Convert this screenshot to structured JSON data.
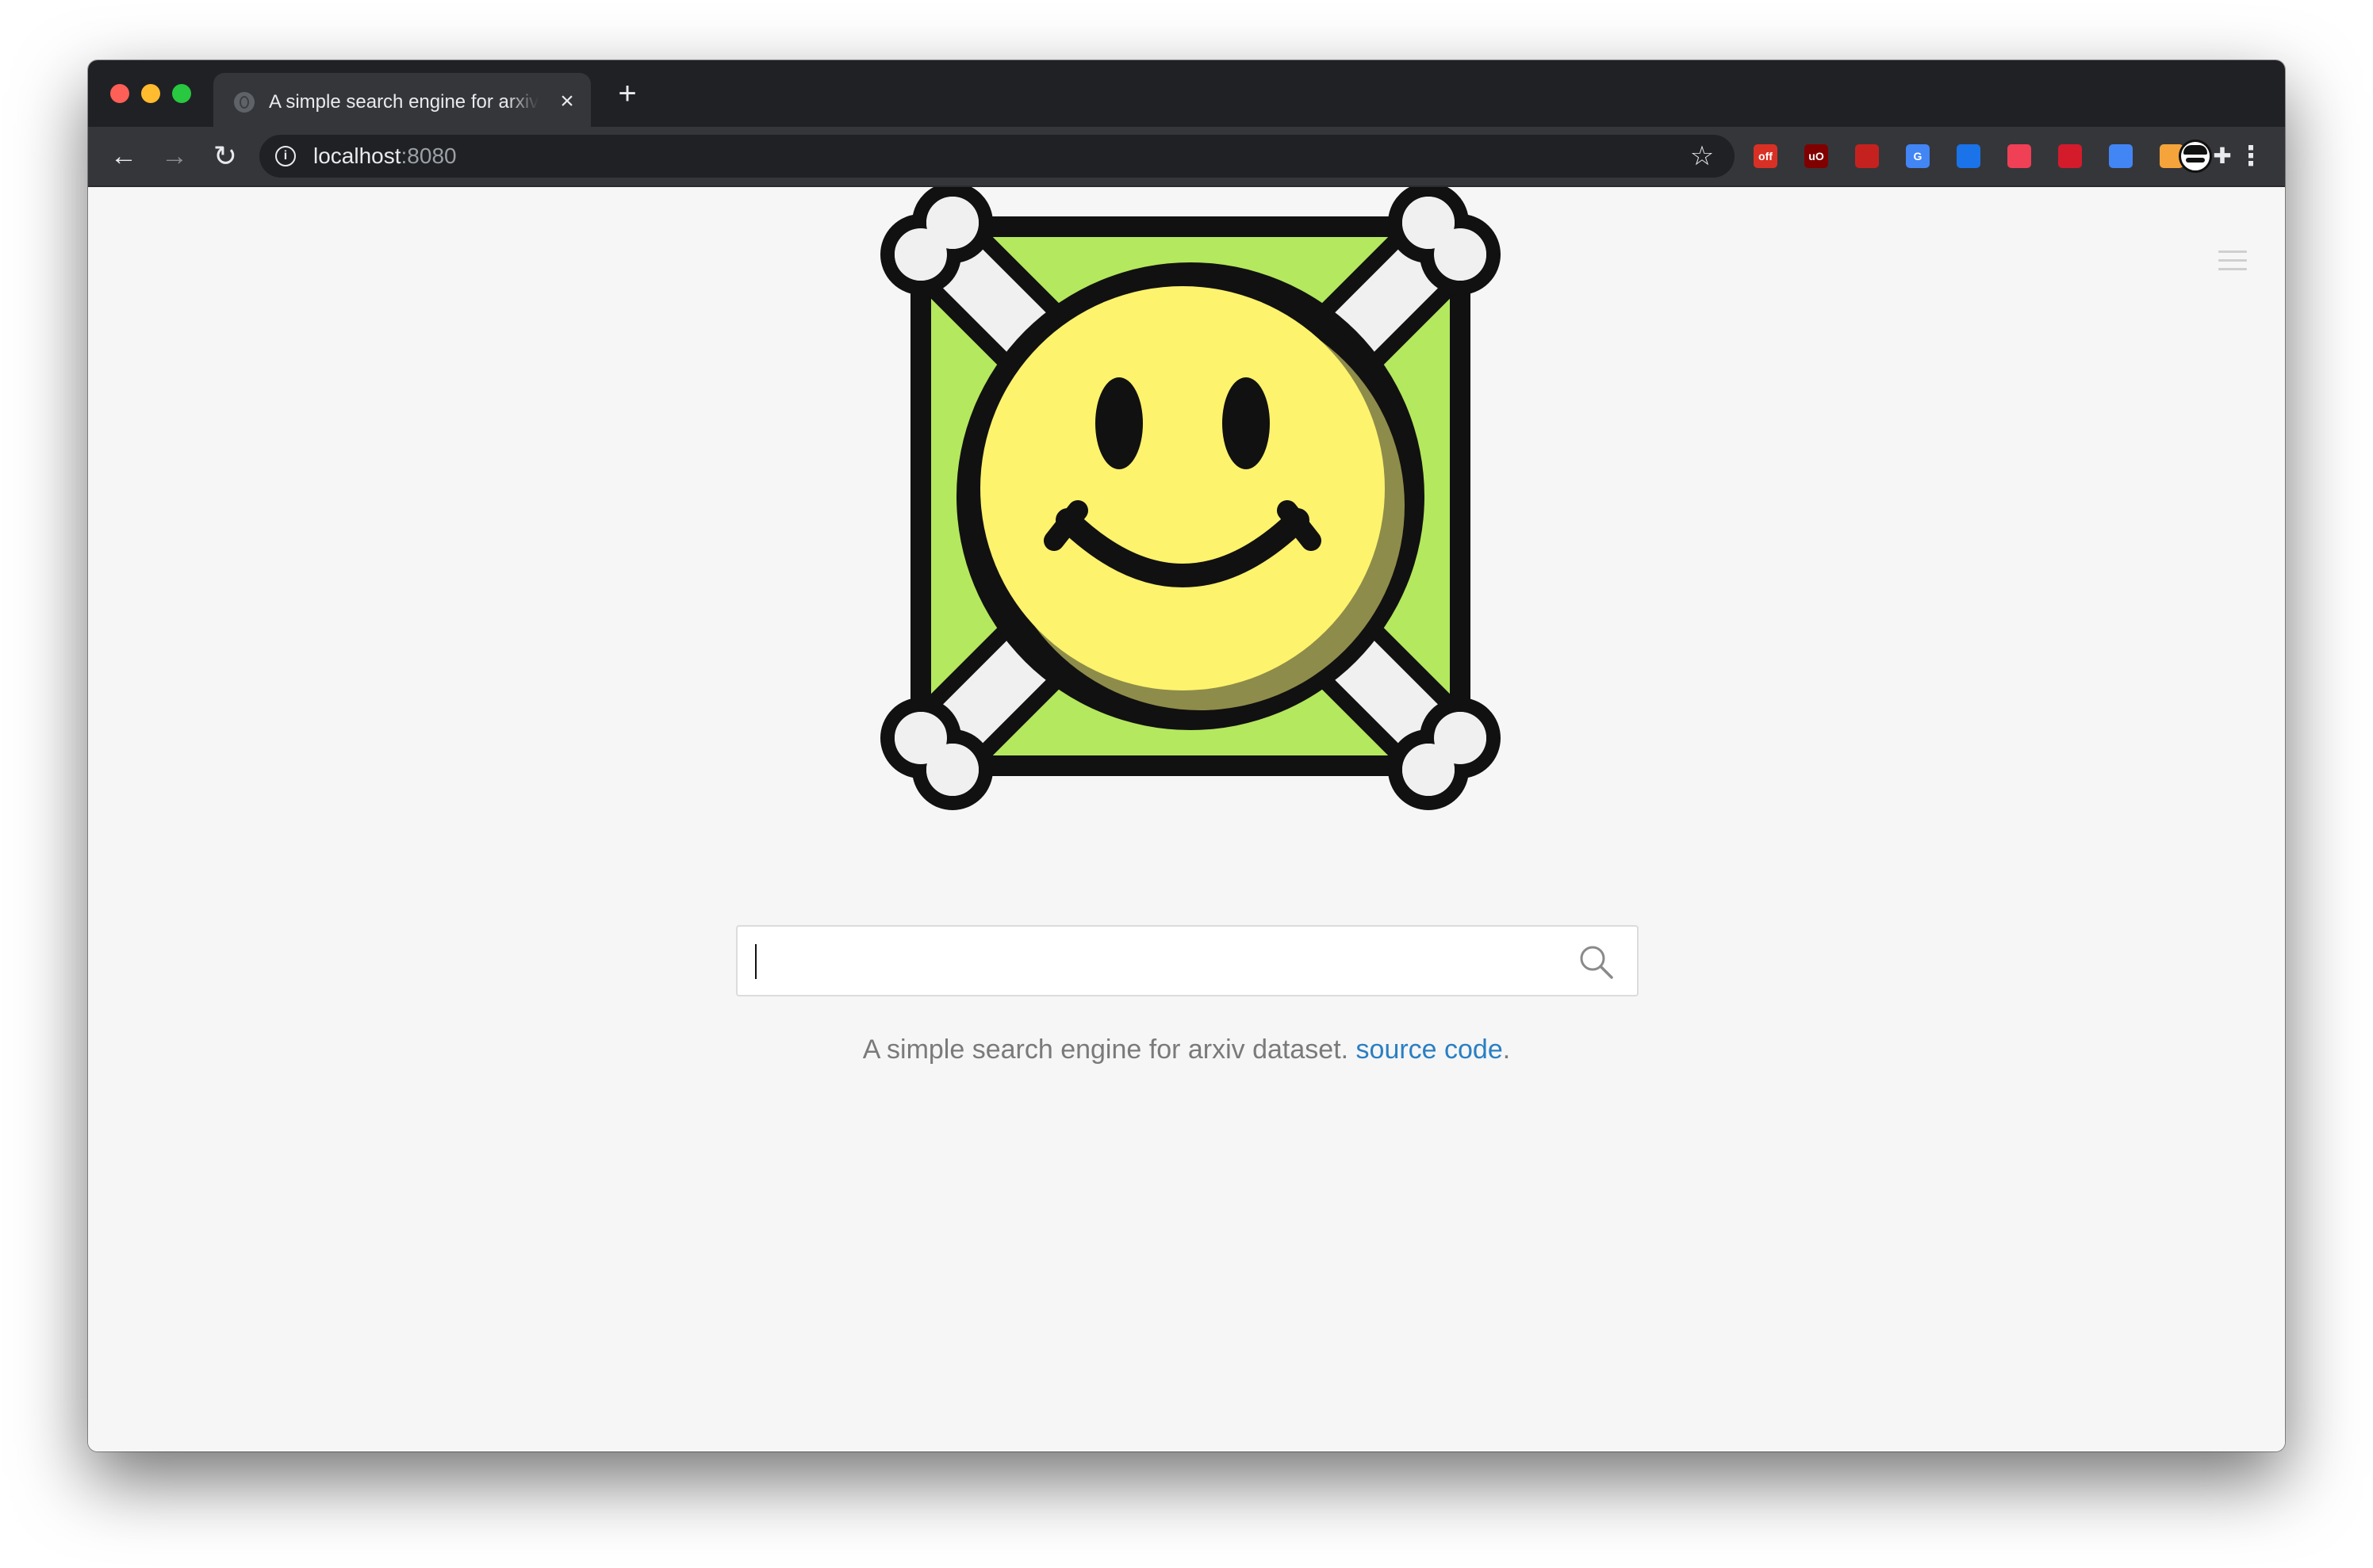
{
  "browser": {
    "tab": {
      "title": "A simple search engine for arxiv dataset",
      "close": "×"
    },
    "new_tab": "+",
    "nav": {
      "back": "←",
      "forward": "→",
      "reload": "↻"
    },
    "address": {
      "host": "localhost",
      "port": ":8080"
    },
    "bookmark_icon": "☆",
    "menu": "⋮",
    "extensions": [
      {
        "name": "off-extension-icon",
        "badge": "off",
        "color": "#d93025"
      },
      {
        "name": "ublock-icon",
        "badge": "uO",
        "color": "#800000"
      },
      {
        "name": "bookmark-ext-icon",
        "badge": "",
        "color": "#c5221f"
      },
      {
        "name": "google-translate-icon",
        "badge": "G",
        "color": "#4285f4"
      },
      {
        "name": "screenshot-ext-icon",
        "badge": "",
        "color": "#1a73e8"
      },
      {
        "name": "pocket-icon",
        "badge": "",
        "color": "#ef4056"
      },
      {
        "name": "mendeley-icon",
        "badge": "",
        "color": "#d41b2c"
      },
      {
        "name": "scholar-icon",
        "badge": "",
        "color": "#4285f4"
      },
      {
        "name": "note-ext-icon",
        "badge": "",
        "color": "#f4a43a"
      },
      {
        "name": "extensions-puzzle-icon",
        "badge": "",
        "color": "#e8eaed"
      }
    ]
  },
  "page": {
    "search": {
      "placeholder": "",
      "value": ""
    },
    "tagline": {
      "text": "A simple search engine for arxiv dataset. ",
      "link": "source code",
      "suffix": "."
    }
  },
  "colors": {
    "link": "#2a7fc3",
    "logo_green": "#b4e85e",
    "logo_yellow": "#fdf36d"
  }
}
